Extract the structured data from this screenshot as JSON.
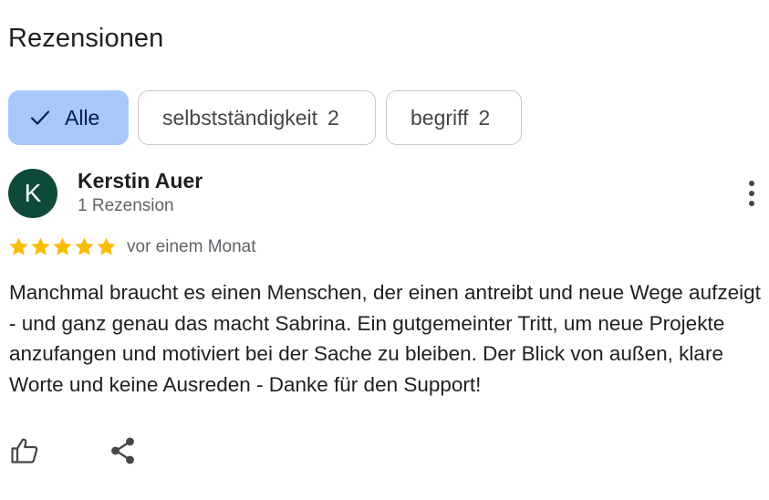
{
  "title": "Rezensionen",
  "filters": [
    {
      "label": "Alle",
      "count": "",
      "selected": true,
      "icon": "check-icon"
    },
    {
      "label": "selbstständigkeit",
      "count": "2",
      "selected": false
    },
    {
      "label": "begriff",
      "count": "2",
      "selected": false
    }
  ],
  "review": {
    "avatar_initial": "K",
    "avatar_color": "#0d4a3a",
    "author": "Kerstin Auer",
    "author_meta": "1 Rezension",
    "rating": 5,
    "rating_max": 5,
    "star_color": "#fbbc04",
    "time": "vor einem Monat",
    "text": "Manchmal braucht es einen Menschen, der einen antreibt und neue Wege aufzeigt - und ganz genau das macht Sabrina. Ein gutgemeinter Tritt, um neue Projekte anzufangen und motiviert bei der Sache zu bleiben. Der Blick von außen, klare Worte und keine Ausreden - Danke für den Support!"
  },
  "actions": {
    "like_icon": "thumb-up-icon",
    "share_icon": "share-icon",
    "more_icon": "more-vert-icon"
  },
  "colors": {
    "selected_chip_bg": "#a8c7fa",
    "chip_border": "#c7c7c7",
    "text_primary": "#1f1f1f",
    "text_secondary": "#5f6368"
  }
}
